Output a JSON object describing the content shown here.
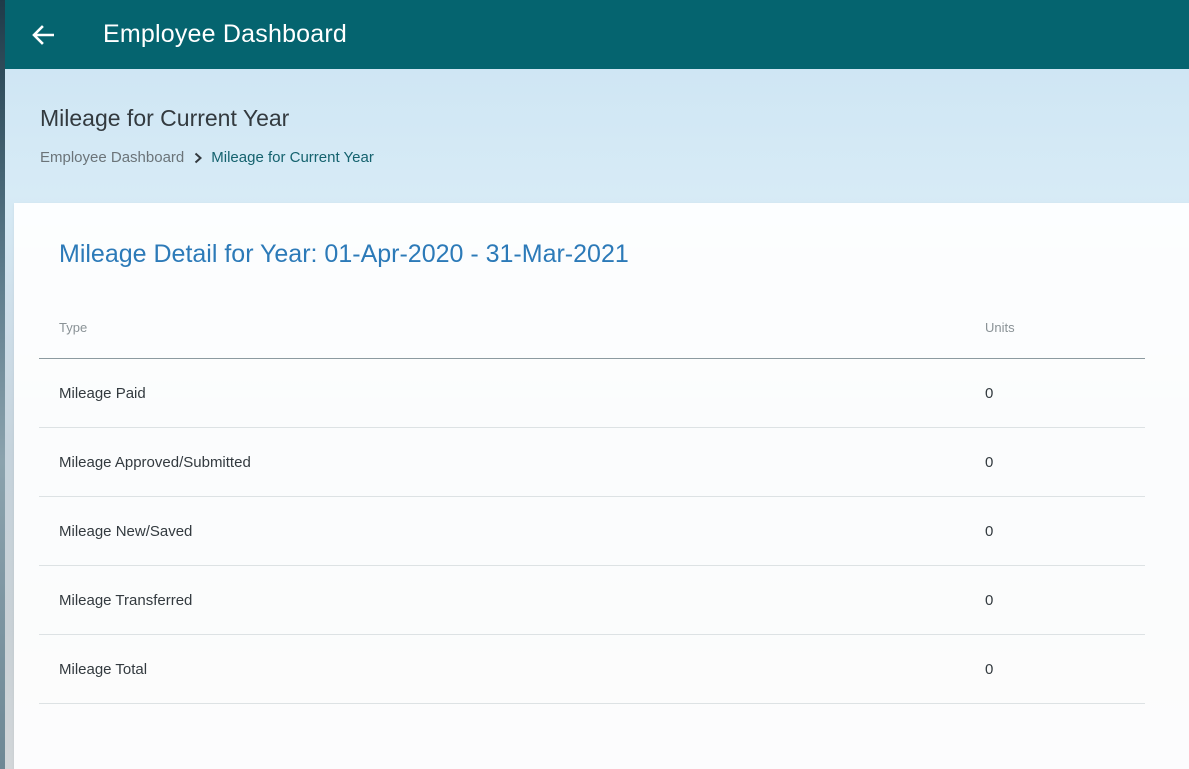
{
  "appbar": {
    "title": "Employee Dashboard",
    "back_icon": "arrow-left-icon",
    "color": "#05646f"
  },
  "header": {
    "title": "Mileage for Current Year",
    "breadcrumb": {
      "root": "Employee Dashboard",
      "separator_icon": "chevron-right-icon",
      "current": "Mileage for Current Year"
    }
  },
  "card": {
    "title": "Mileage Detail for Year: 01-Apr-2020 - 31-Mar-2021",
    "title_color": "#2c7ab8",
    "columns": {
      "type": "Type",
      "units": "Units"
    },
    "rows": [
      {
        "type": "Mileage Paid",
        "units": "0"
      },
      {
        "type": "Mileage Approved/Submitted",
        "units": "0"
      },
      {
        "type": "Mileage New/Saved",
        "units": "0"
      },
      {
        "type": "Mileage Transferred",
        "units": "0"
      },
      {
        "type": "Mileage Total",
        "units": "0"
      }
    ]
  }
}
